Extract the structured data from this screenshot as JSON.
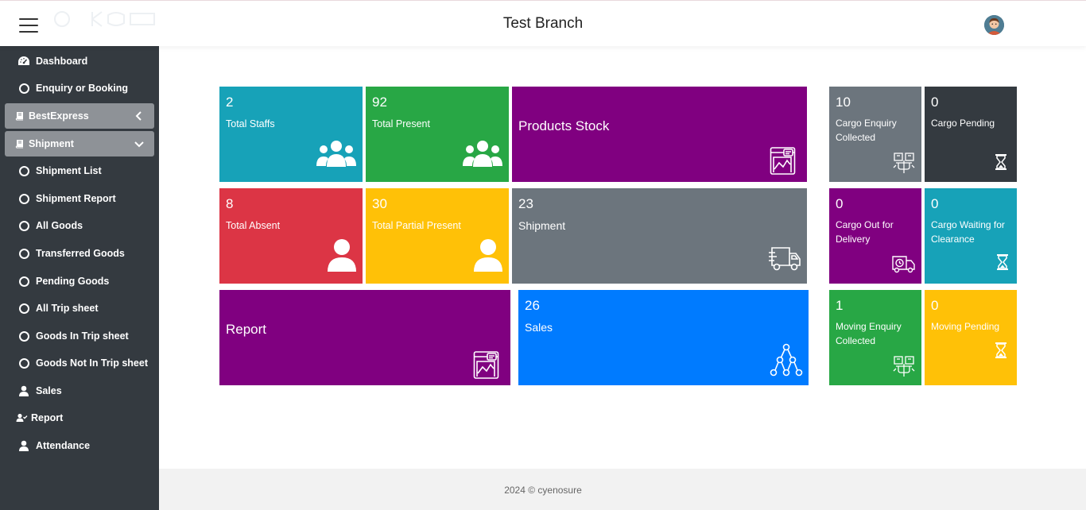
{
  "header": {
    "title": "Test Branch"
  },
  "sidebar": {
    "items": [
      {
        "label": "Dashboard",
        "icon": "dashboard-icon"
      },
      {
        "label": "Enquiry or Booking",
        "icon": "circle-icon"
      },
      {
        "label": "BestExpress",
        "icon": "book-icon",
        "group": true,
        "expanded": false
      },
      {
        "label": "Shipment",
        "icon": "book-icon",
        "group": true,
        "expanded": true
      },
      {
        "label": "Shipment List",
        "icon": "circle-icon"
      },
      {
        "label": "Shipment Report",
        "icon": "circle-icon"
      },
      {
        "label": "All Goods",
        "icon": "circle-icon"
      },
      {
        "label": "Transferred Goods",
        "icon": "circle-icon"
      },
      {
        "label": "Pending Goods",
        "icon": "circle-icon"
      },
      {
        "label": "All Trip sheet",
        "icon": "circle-icon"
      },
      {
        "label": "Goods In Trip sheet",
        "icon": "circle-icon"
      },
      {
        "label": "Goods Not In Trip sheet",
        "icon": "circle-icon"
      },
      {
        "label": "Sales",
        "icon": "user-icon"
      },
      {
        "label": "Report",
        "icon": "user-check-icon"
      },
      {
        "label": "Attendance",
        "icon": "user-icon"
      }
    ]
  },
  "tiles": {
    "total_staffs": {
      "value": "2",
      "label": "Total Staffs",
      "color": "#17a2b8",
      "icon": "users-icon"
    },
    "total_present": {
      "value": "92",
      "label": "Total Present",
      "color": "#28a745",
      "icon": "users-icon"
    },
    "products_stock": {
      "label": "Products Stock",
      "color": "#800080",
      "icon": "chart-window-icon"
    },
    "total_absent": {
      "value": "8",
      "label": "Total Absent",
      "color": "#dc3545",
      "icon": "user-icon"
    },
    "total_partial_present": {
      "value": "30",
      "label": "Total Partial Present",
      "color": "#ffc107",
      "icon": "user-icon"
    },
    "shipment": {
      "value": "23",
      "label": "Shipment",
      "color": "#6c757d",
      "icon": "truck-icon"
    },
    "report": {
      "label": "Report",
      "color": "#800080",
      "icon": "chart-window-icon"
    },
    "sales": {
      "value": "26",
      "label": "Sales",
      "color": "#007bff",
      "icon": "network-icon"
    },
    "cargo_enquiry_collected": {
      "value": "10",
      "label": "Cargo Enquiry Collected",
      "color": "#6c757d",
      "icon": "boxes-icon"
    },
    "cargo_pending": {
      "value": "0",
      "label": "Cargo Pending",
      "color": "#343a40",
      "icon": "hourglass-icon"
    },
    "cargo_out_for_delivery": {
      "value": "0",
      "label": "Cargo Out for Delivery",
      "color": "#800080",
      "icon": "delivery-truck-icon"
    },
    "cargo_waiting_for_clearance": {
      "value": "0",
      "label": "Cargo Waiting for Clearance",
      "color": "#17a2b8",
      "icon": "hourglass-icon"
    },
    "moving_enquiry_collected": {
      "value": "1",
      "label": "Moving Enquiry Collected",
      "color": "#28a745",
      "icon": "boxes-icon"
    },
    "moving_pending": {
      "value": "0",
      "label": "Moving Pending",
      "color": "#ffc107",
      "icon": "hourglass-icon"
    }
  },
  "footer": {
    "text": "2024 © cyenosure"
  }
}
